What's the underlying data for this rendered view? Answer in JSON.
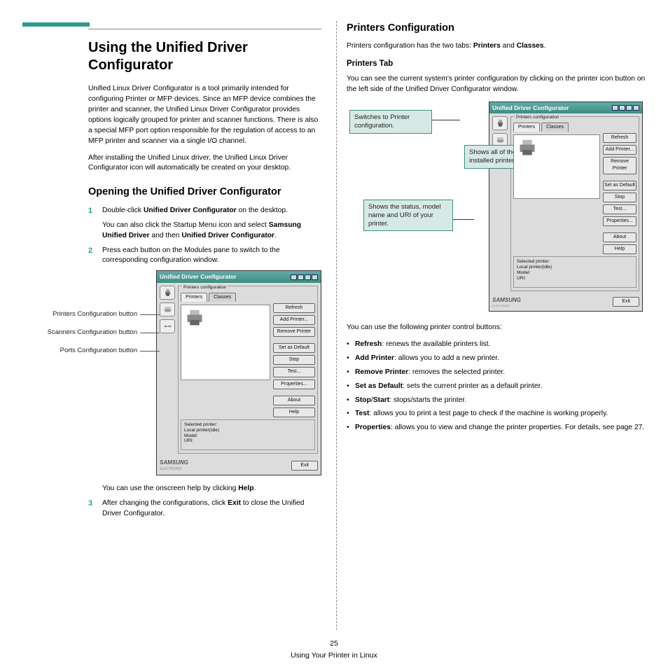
{
  "accent_color": "#2f9a8a",
  "page": {
    "number": "25",
    "section_footer": "Using Your Printer in Linux"
  },
  "left": {
    "h1": "Using the Unified Driver Configurator",
    "intro1": "Unified Linux Driver Configurator is a tool primarily intended for configuring Printer or MFP devices. Since an MFP device combines the printer and scanner, the Unified Linux Driver Configurator provides options logically grouped for printer and scanner functions. There is also a special MFP port option responsible for the regulation of access to an MFP printer and scanner via a single I/O channel.",
    "intro2": "After installing the Unified Linux driver, the Unified Linux Driver Configurator icon will automatically be created on your desktop.",
    "h2": "Opening the Unified Driver Configurator",
    "step1_a": "Double-click ",
    "step1_b": "Unified Driver Configurator",
    "step1_c": " on the desktop.",
    "step1_sub_a": "You can also click the Startup Menu icon and select ",
    "step1_sub_b": "Samsung Unified Driver",
    "step1_sub_c": " and then ",
    "step1_sub_d": "Unified Driver Configurator",
    "step1_sub_e": ".",
    "step2": "Press each button on the Modules pane to switch to the corresponding configuration window.",
    "side_label_1": "Printers Configuration button",
    "side_label_2": "Scanners Configuration button",
    "side_label_3": "Ports Configuration button",
    "step2_after_a": "You can use the onscreen help by clicking ",
    "step2_after_b": "Help",
    "step2_after_c": ".",
    "step3_a": "After changing the configurations, click ",
    "step3_b": "Exit",
    "step3_c": " to close the Unified Driver Configurator."
  },
  "right": {
    "h2": "Printers Configuration",
    "intro_a": "Printers configuration has the two tabs: ",
    "intro_b": "Printers",
    "intro_c": " and ",
    "intro_d": "Classes",
    "intro_e": ".",
    "h3": "Printers Tab",
    "p1": "You can see the current system's printer configuration by clicking on the printer icon button on the left side of the Unified Driver Configurator window.",
    "callout_switch": "Switches to Printer configuration.",
    "callout_shows_all": "Shows all of the installed printer.",
    "callout_status": "Shows the status, model name and URI of your printer.",
    "p2": "You can use the following printer control buttons:",
    "bullet_refresh_a": "Refresh",
    "bullet_refresh_b": ": renews the available printers list.",
    "bullet_add_a": "Add Printer",
    "bullet_add_b": ": allows you to add a new printer.",
    "bullet_remove_a": "Remove Printer",
    "bullet_remove_b": ": removes the selected printer.",
    "bullet_default_a": "Set as Default",
    "bullet_default_b": ": sets the current printer as a default printer.",
    "bullet_stop_a": "Stop",
    "bullet_stop_b": "/",
    "bullet_stop_c": "Start",
    "bullet_stop_d": ": stops/starts the printer.",
    "bullet_test_a": "Test",
    "bullet_test_b": ": allows you to print a test page to check if the machine is working properly.",
    "bullet_prop_a": "Properties",
    "bullet_prop_b": ": allows you to view and change the printer properties. For details, see page 27."
  },
  "app": {
    "title": "Unified Driver Configurator",
    "fieldset_label": "Printers configuration",
    "tab_printers": "Printers",
    "tab_classes": "Classes",
    "buttons": {
      "refresh": "Refresh",
      "add": "Add Printer...",
      "remove": "Remove Printer",
      "setdef": "Set as Default",
      "stop": "Stop",
      "test": "Test...",
      "props": "Properties...",
      "about": "About",
      "help": "Help"
    },
    "selected_label": "Selected printer:",
    "selected_line1": "Local printer(idle)",
    "selected_line2": "Model:",
    "selected_line3": "URI:",
    "exit": "Exit",
    "logo": "SAMSUNG",
    "electronic": "ELECTRONIC"
  }
}
